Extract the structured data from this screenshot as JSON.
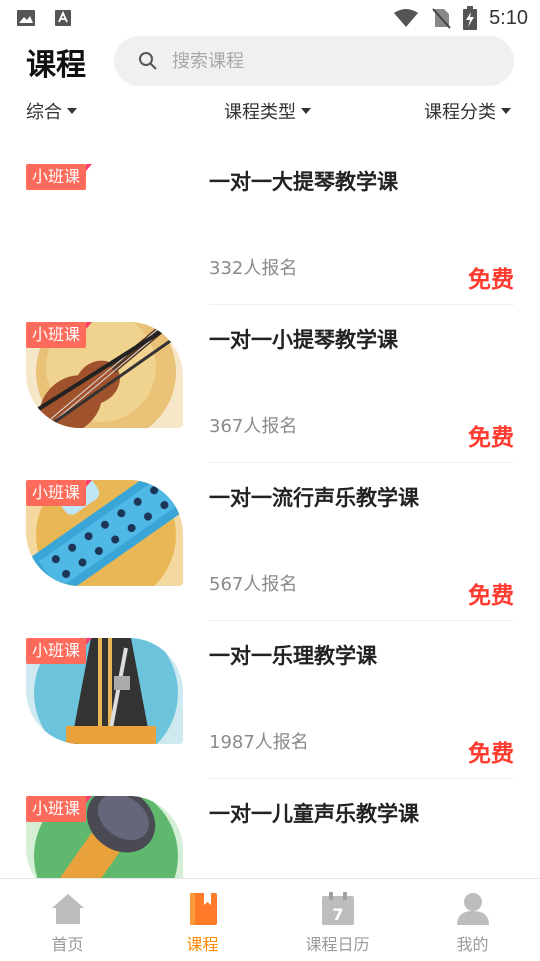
{
  "status": {
    "time": "5:10"
  },
  "header": {
    "title": "课程",
    "search_placeholder": "搜索课程"
  },
  "filters": [
    {
      "label": "综合"
    },
    {
      "label": "课程类型"
    },
    {
      "label": "课程分类"
    }
  ],
  "courses": [
    {
      "badge": "小班课",
      "title": "一对一大提琴教学课",
      "enrolled": "332人报名",
      "price": "免费",
      "thumbnail": "none"
    },
    {
      "badge": "小班课",
      "title": "一对一小提琴教学课",
      "enrolled": "367人报名",
      "price": "免费",
      "thumbnail": "violin"
    },
    {
      "badge": "小班课",
      "title": "一对一流行声乐教学课",
      "enrolled": "567人报名",
      "price": "免费",
      "thumbnail": "harmonica"
    },
    {
      "badge": "小班课",
      "title": "一对一乐理教学课",
      "enrolled": "1987人报名",
      "price": "免费",
      "thumbnail": "metronome"
    },
    {
      "badge": "小班课",
      "title": "一对一儿童声乐教学课",
      "enrolled": "",
      "price": "",
      "thumbnail": "microphone"
    }
  ],
  "bottom_nav": [
    {
      "label": "首页",
      "icon": "home-icon"
    },
    {
      "label": "课程",
      "icon": "book-icon"
    },
    {
      "label": "课程日历",
      "icon": "calendar-icon",
      "calendar_day": "7"
    },
    {
      "label": "我的",
      "icon": "person-icon"
    }
  ],
  "colors": {
    "accent": "#ff8a00",
    "price": "#ff3b30",
    "badge": "#ff6b5b"
  }
}
